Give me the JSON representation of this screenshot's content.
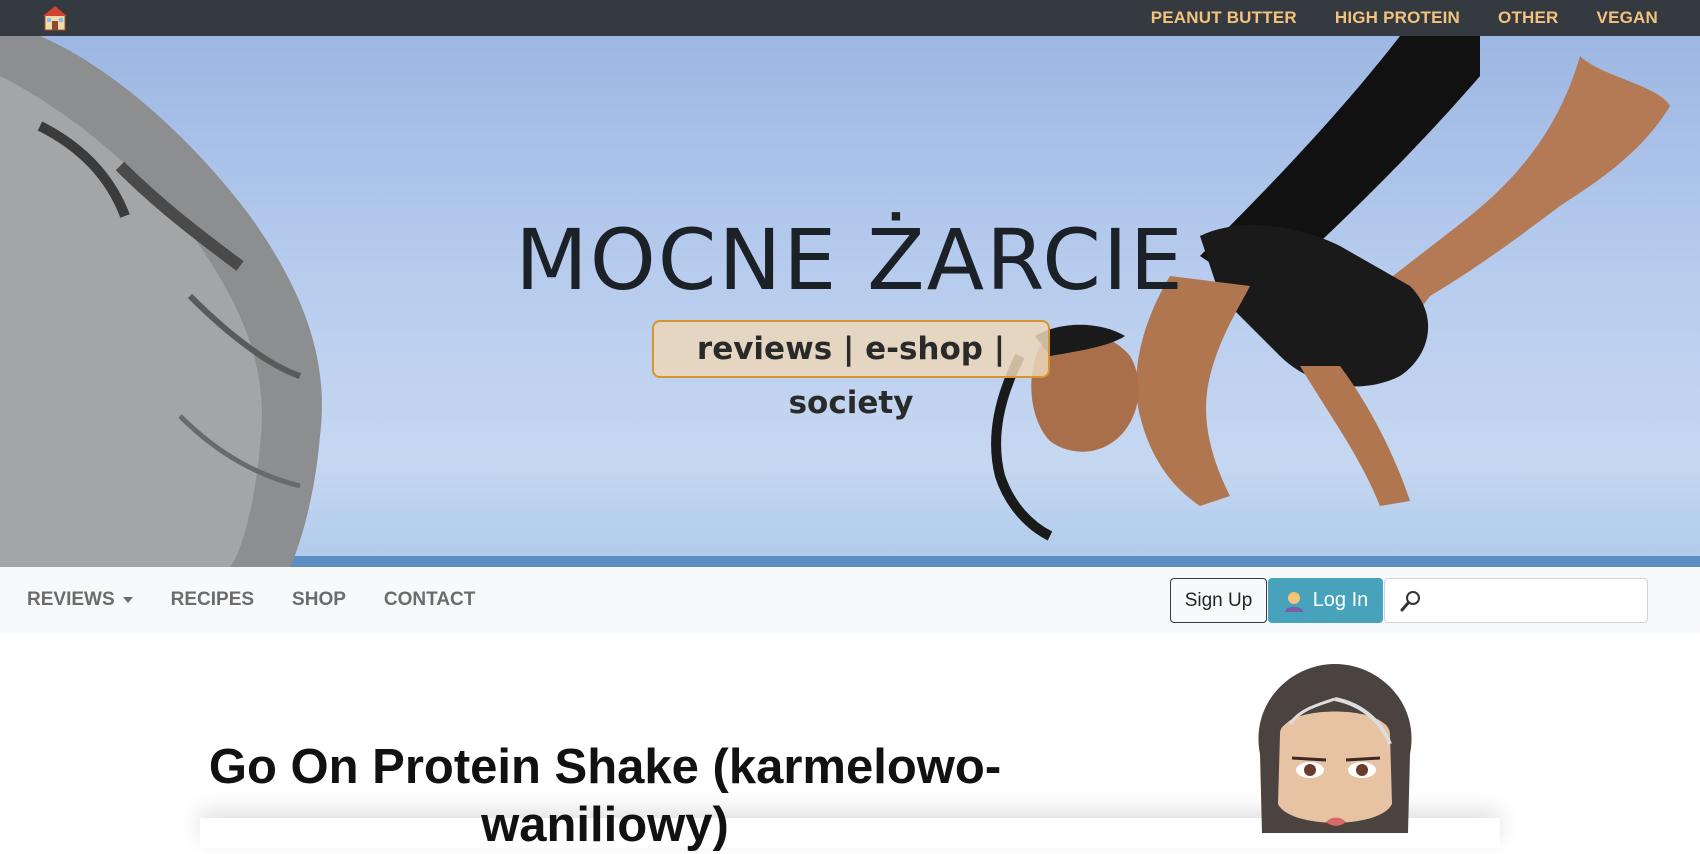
{
  "topbar": {
    "home_icon": "house-icon",
    "links": [
      "PEANUT BUTTER",
      "HIGH PROTEIN",
      "OTHER",
      "VEGAN"
    ]
  },
  "hero": {
    "title": "MOCNE ŻARCIE",
    "tagline": "reviews | e-shop | society"
  },
  "navbar": {
    "items": [
      "REVIEWS",
      "RECIPES",
      "SHOP",
      "CONTACT"
    ],
    "signup_label": "Sign Up",
    "login_label": "Log In",
    "login_icon": "person-icon",
    "search_icon": "magnifier-icon",
    "search_placeholder": ""
  },
  "article": {
    "title": "Go On Protein Shake (karmelowo-waniliowy)"
  },
  "colors": {
    "topbar_bg": "#343a40",
    "top_link": "#f3c37e",
    "login_bg": "#46a3bb",
    "tagline_border": "#d6952e"
  }
}
